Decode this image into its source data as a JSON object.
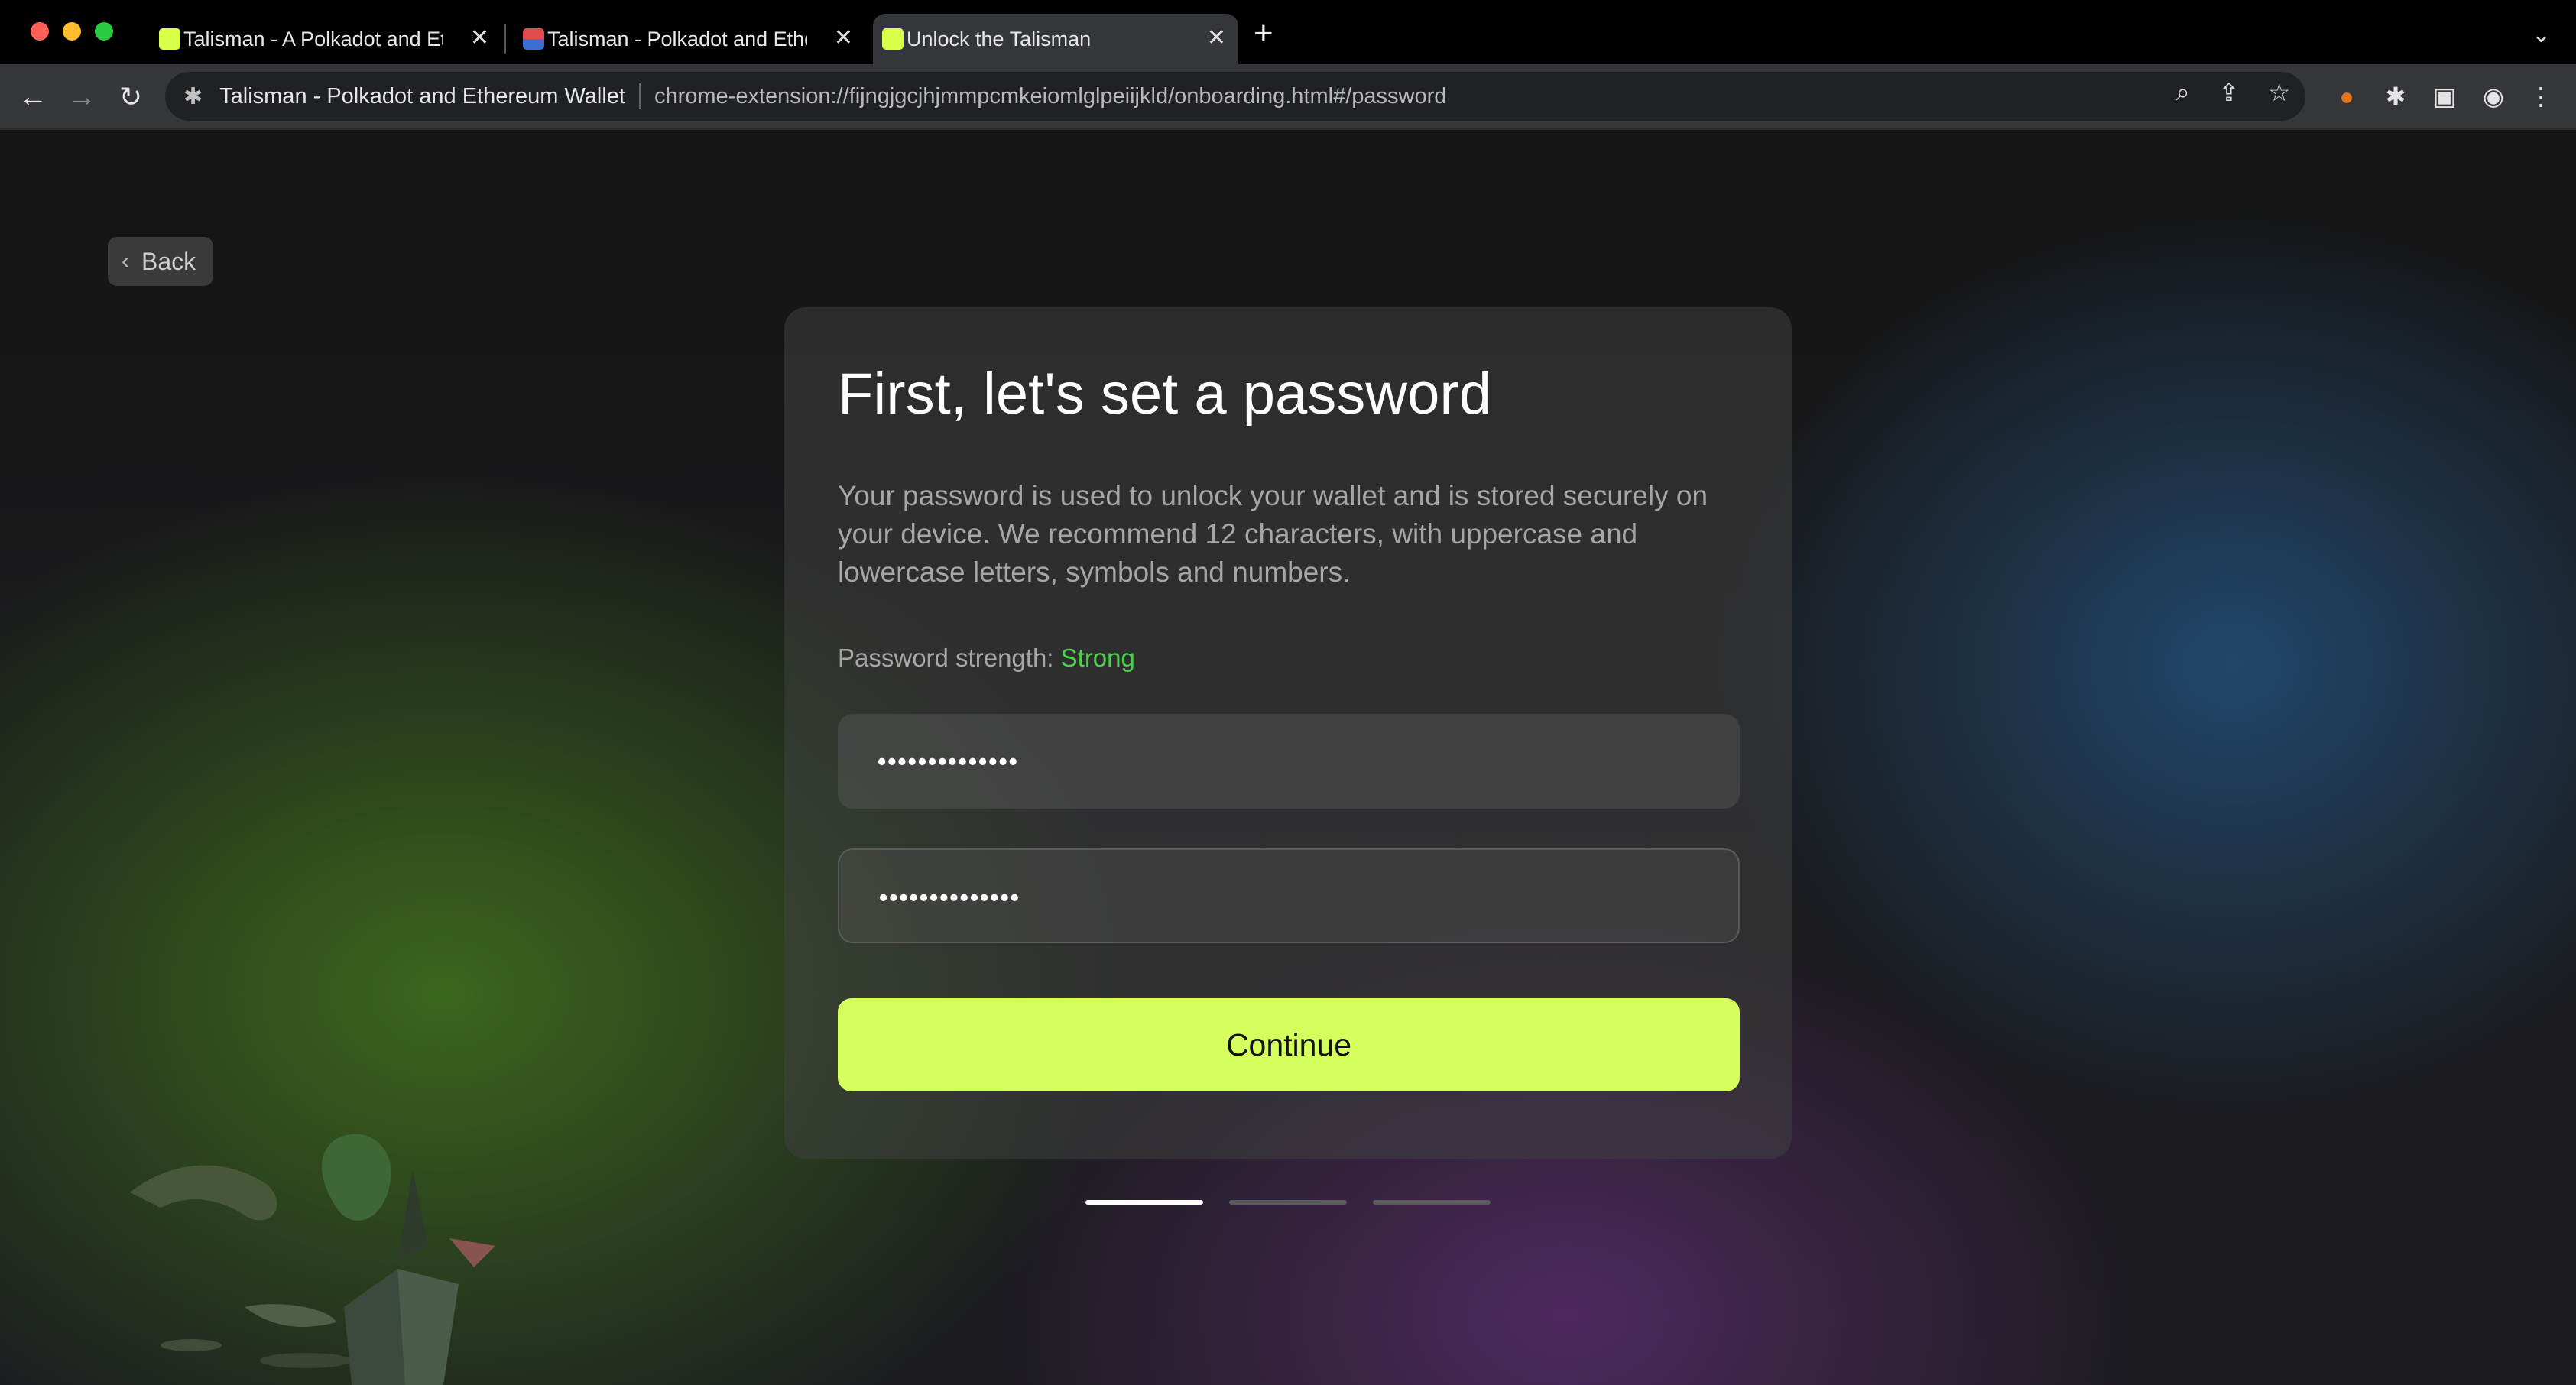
{
  "browser": {
    "tabs": [
      {
        "title": "Talisman - A Polkadot and Eth",
        "active": false
      },
      {
        "title": "Talisman - Polkadot and Ether",
        "active": false
      },
      {
        "title": "Unlock the Talisman",
        "active": true
      }
    ],
    "tab_close_glyph": "✕",
    "new_tab_glyph": "+",
    "tab_menu_glyph": "⌄",
    "site_name": "Talisman - Polkadot and Ethereum Wallet",
    "url": "chrome-extension://fijngjgcjhjmmpcmkeiomlglpeiijkld/onboarding.html#/password"
  },
  "page": {
    "back_label": "Back",
    "heading": "First, let's set a password",
    "description": "Your password is used to unlock your wallet and is stored securely on your device. We recommend 12 characters, with uppercase and lowercase letters, symbols and numbers.",
    "strength_label": "Password strength:",
    "strength_value": "Strong",
    "password_value": "••••••••••••••",
    "confirm_value": "••••••••••••••",
    "continue_label": "Continue",
    "steps_total": 3,
    "current_step": 1
  },
  "colors": {
    "accent": "#d5ff5c",
    "strength_strong": "#4ad24a",
    "step_active": "#ffffff",
    "step_inactive": "#5a5a5a"
  }
}
